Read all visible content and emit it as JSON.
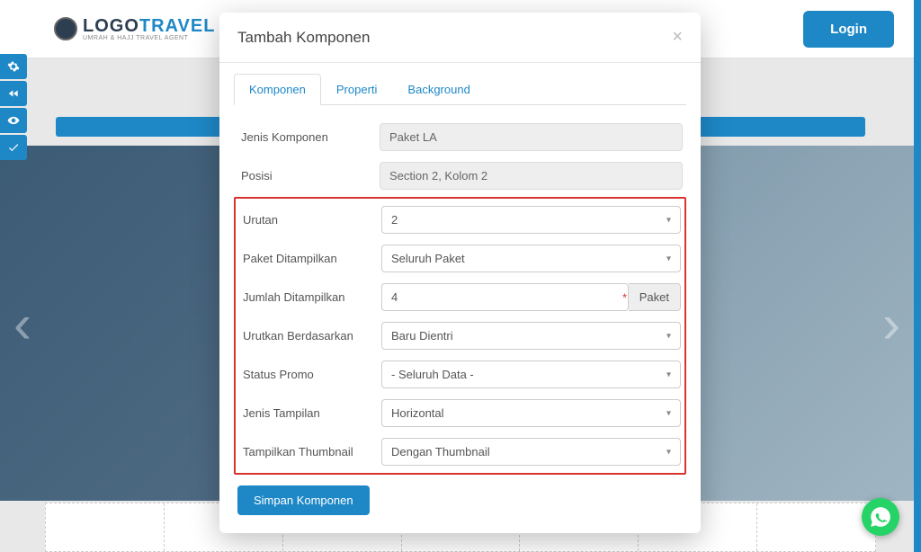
{
  "header": {
    "logo_brand_dark": "LOGO",
    "logo_brand_blue": "TRAVEL",
    "logo_tagline": "UMRAH & HAJJ TRAVEL AGENT",
    "login_label": "Login"
  },
  "modal": {
    "title": "Tambah Komponen",
    "tabs": {
      "komponen": "Komponen",
      "properti": "Properti",
      "background": "Background"
    },
    "fields": {
      "jenis_komponen": {
        "label": "Jenis Komponen",
        "value": "Paket LA"
      },
      "posisi": {
        "label": "Posisi",
        "value": "Section 2, Kolom 2"
      },
      "urutan": {
        "label": "Urutan",
        "value": "2"
      },
      "paket_ditampilkan": {
        "label": "Paket Ditampilkan",
        "value": "Seluruh Paket"
      },
      "jumlah_ditampilkan": {
        "label": "Jumlah Ditampilkan",
        "value": "4",
        "unit": "Paket"
      },
      "urutkan_berdasarkan": {
        "label": "Urutkan Berdasarkan",
        "value": "Baru Dientri"
      },
      "status_promo": {
        "label": "Status Promo",
        "value": "- Seluruh Data -"
      },
      "jenis_tampilan": {
        "label": "Jenis Tampilan",
        "value": "Horizontal"
      },
      "tampilkan_thumbnail": {
        "label": "Tampilkan Thumbnail",
        "value": "Dengan Thumbnail"
      }
    },
    "submit_label": "Simpan Komponen"
  }
}
